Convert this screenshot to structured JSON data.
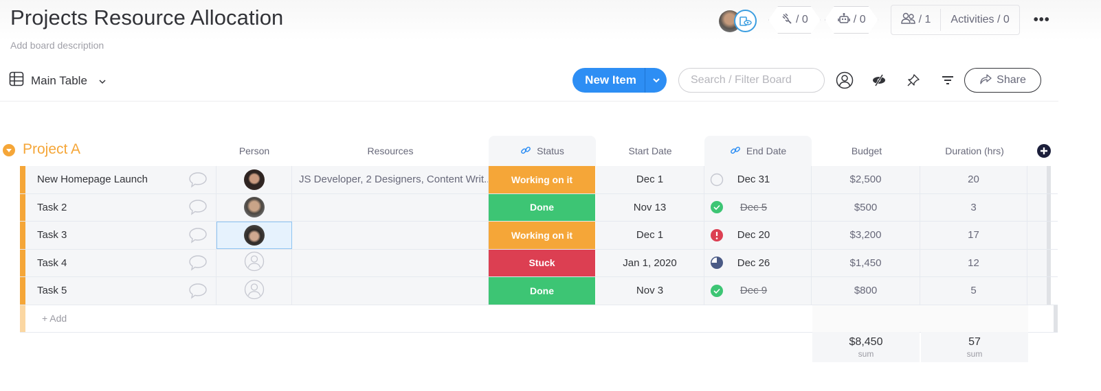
{
  "board": {
    "title": "Projects Resource Allocation",
    "description_placeholder": "Add board description"
  },
  "header_right": {
    "integrations_count": "/ 0",
    "automations_count": "/ 0",
    "members_count": "/ 1",
    "activities_label": "Activities / 0",
    "more_label": "•••"
  },
  "toolbar": {
    "view_label": "Main Table",
    "new_item_label": "New Item",
    "search_placeholder": "Search / Filter Board",
    "share_label": "Share"
  },
  "group": {
    "title": "Project A",
    "color": "#f5a638",
    "columns": {
      "person": "Person",
      "resources": "Resources",
      "status": "Status",
      "start_date": "Start Date",
      "end_date": "End Date",
      "budget": "Budget",
      "duration": "Duration (hrs)"
    },
    "rows": [
      {
        "name": "New Homepage Launch",
        "person": "photo-woman",
        "resources": "JS Developer, 2 Designers, Content Writ...",
        "status": "Working on it",
        "status_color": "#f5a638",
        "start": "Dec 1",
        "end": "Dec 31",
        "end_indicator": "empty",
        "budget": "$2,500",
        "duration": "20"
      },
      {
        "name": "Task 2",
        "person": "photo-man-beard",
        "resources": "",
        "status": "Done",
        "status_color": "#3dc574",
        "start": "Nov 13",
        "end": "Dec 5",
        "end_indicator": "done",
        "budget": "$500",
        "duration": "3"
      },
      {
        "name": "Task 3",
        "person": "photo-man-glasses",
        "resources": "",
        "status": "Working on it",
        "status_color": "#f5a638",
        "start": "Dec 1",
        "end": "Dec 20",
        "end_indicator": "overdue",
        "budget": "$3,200",
        "duration": "17"
      },
      {
        "name": "Task 4",
        "person": "empty",
        "resources": "",
        "status": "Stuck",
        "status_color": "#dc3f52",
        "start": "Jan 1, 2020",
        "end": "Dec 26",
        "end_indicator": "progress",
        "budget": "$1,450",
        "duration": "12"
      },
      {
        "name": "Task 5",
        "person": "empty",
        "resources": "",
        "status": "Done",
        "status_color": "#3dc574",
        "start": "Nov 3",
        "end": "Dec 9",
        "end_indicator": "done",
        "budget": "$800",
        "duration": "5"
      }
    ],
    "add_label": "+ Add",
    "summary": {
      "budget": {
        "value": "$8,450",
        "label": "sum"
      },
      "duration": {
        "value": "57",
        "label": "sum"
      }
    }
  }
}
